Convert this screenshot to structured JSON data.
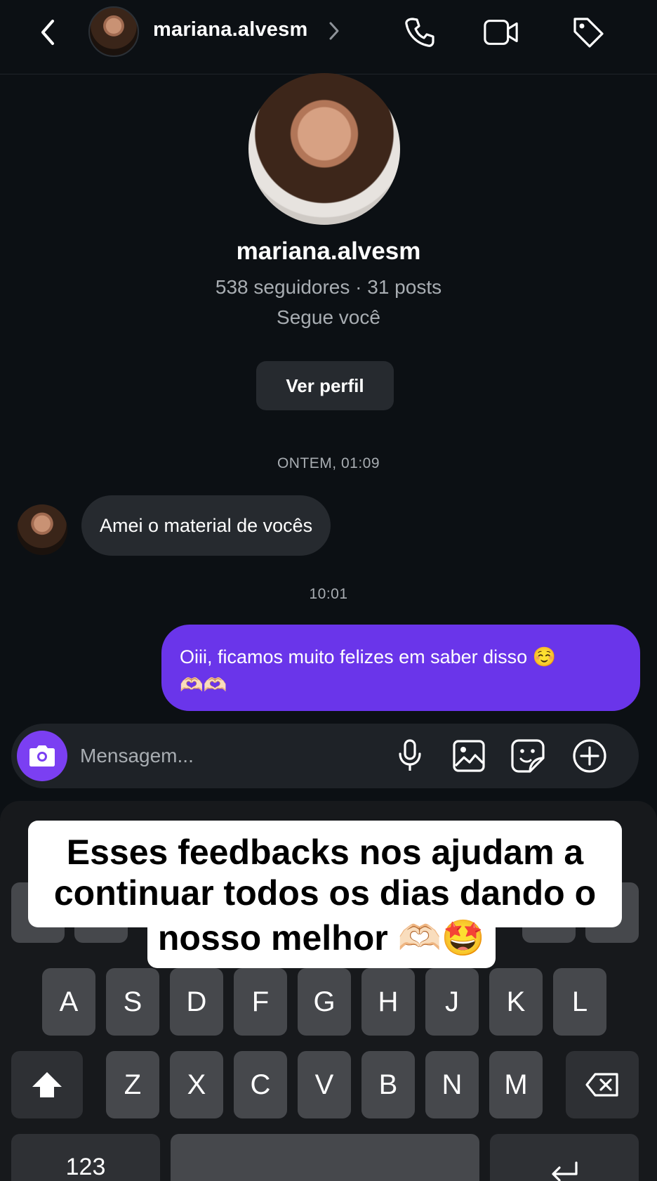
{
  "header": {
    "username": "mariana.alvesm",
    "icons": [
      "back-icon",
      "chevron-right-icon",
      "phone-icon",
      "video-icon",
      "tag-icon"
    ]
  },
  "profile": {
    "name": "mariana.alvesm",
    "stats": "538 seguidores · 31 posts",
    "follow_status": "Segue você",
    "view_profile_label": "Ver perfil"
  },
  "chat": {
    "timestamp_1": "ONTEM, 01:09",
    "incoming_message": "Amei o material de vocês",
    "timestamp_2": "10:01",
    "outgoing_line_1": "Oiii, ficamos muito felizes em saber disso ☺️",
    "outgoing_line_2": "🫶🏻🫶🏻"
  },
  "composer": {
    "placeholder": "Mensagem...",
    "icons": [
      "camera-icon",
      "microphone-icon",
      "gallery-icon",
      "sticker-icon",
      "plus-icon"
    ]
  },
  "keyboard": {
    "row2": [
      "A",
      "S",
      "D",
      "F",
      "G",
      "H",
      "J",
      "K",
      "L"
    ],
    "row3": [
      "Z",
      "X",
      "C",
      "V",
      "B",
      "N",
      "M"
    ],
    "numbers_label": "123"
  },
  "caption": {
    "line_1": "Esses feedbacks nos ajudam a",
    "line_2": "continuar todos os dias dando o",
    "line_3": "nosso melhor 🫶🏻🤩"
  },
  "colors": {
    "background": "#0c1014",
    "outgoing_bubble": "#6a35ea",
    "camera_button": "#7b3ff2",
    "incoming_bubble": "#262a2f"
  }
}
